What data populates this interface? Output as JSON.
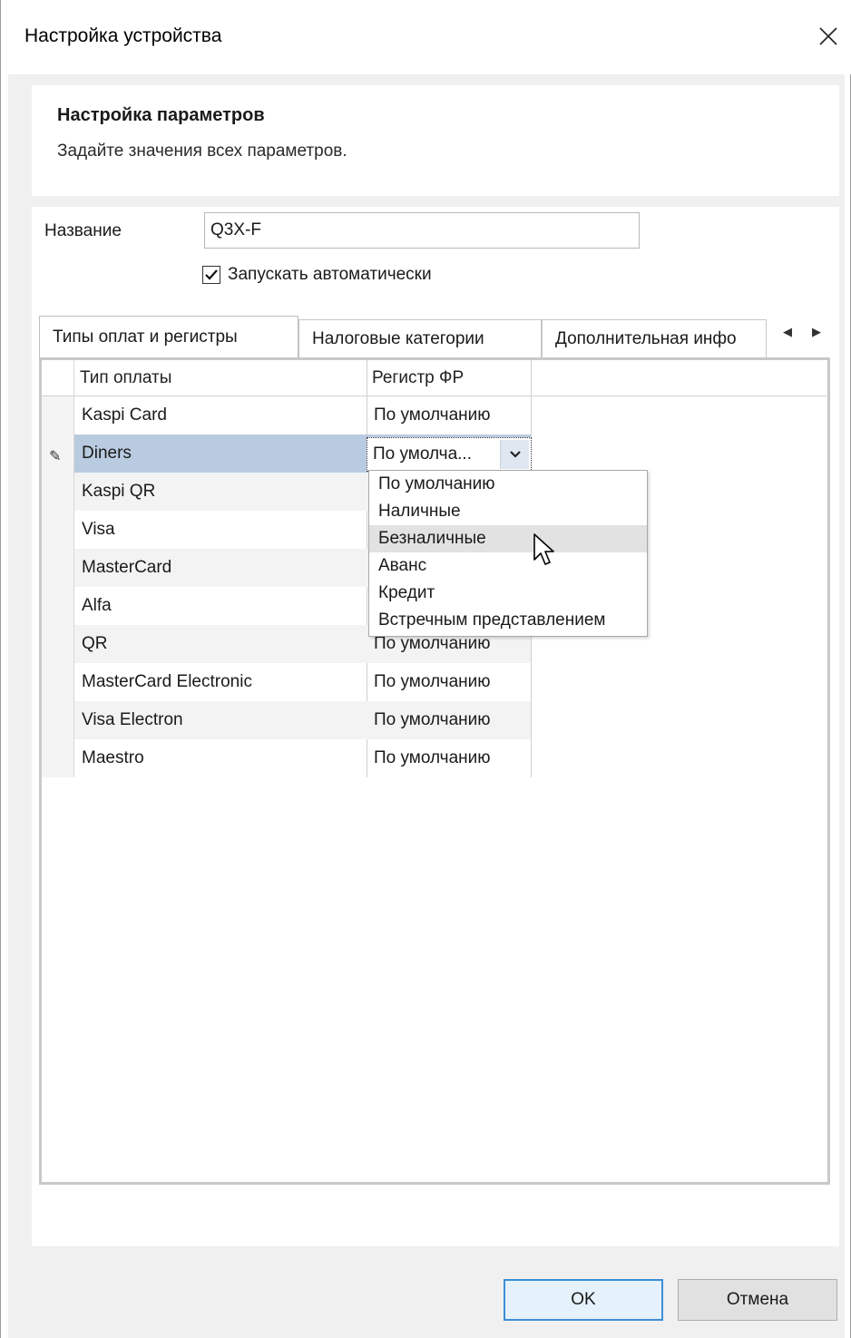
{
  "window": {
    "title": "Настройка устройства"
  },
  "header": {
    "title": "Настройка параметров",
    "subtitle": "Задайте значения всех параметров."
  },
  "form": {
    "name_label": "Название",
    "name_value": "Q3X-F",
    "autostart_label": "Запускать автоматически",
    "autostart_checked": true
  },
  "tabs": [
    {
      "label": "Типы оплат и регистры",
      "active": true
    },
    {
      "label": "Налоговые категории",
      "active": false
    },
    {
      "label": "Дополнительная инфо",
      "active": false
    }
  ],
  "grid": {
    "columns": [
      "Тип оплаты",
      "Регистр ФР"
    ],
    "rows": [
      {
        "type": "Kaspi Card",
        "register": "По умолчанию"
      },
      {
        "type": "Diners",
        "register": "По умолча...",
        "selected": true,
        "editing": true
      },
      {
        "type": "Kaspi QR",
        "register": ""
      },
      {
        "type": "Visa",
        "register": ""
      },
      {
        "type": "MasterCard",
        "register": ""
      },
      {
        "type": "Alfa",
        "register": ""
      },
      {
        "type": "QR",
        "register": "По умолчанию"
      },
      {
        "type": "MasterCard Electronic",
        "register": "По умолчанию"
      },
      {
        "type": "Visa Electron",
        "register": "По умолчанию"
      },
      {
        "type": "Maestro",
        "register": "По умолчанию"
      }
    ]
  },
  "dropdown": {
    "options": [
      "По умолчанию",
      "Наличные",
      "Безналичные",
      "Аванс",
      "Кредит",
      "Встречным представлением"
    ],
    "highlighted": "Безналичные"
  },
  "buttons": {
    "ok": "OK",
    "cancel": "Отмена"
  },
  "icons": {
    "close": "close-icon",
    "check": "checkmark-icon",
    "edit": "pencil-icon",
    "combo": "chevron-down-icon",
    "tab_left": "arrow-left-icon",
    "tab_right": "arrow-right-icon",
    "cursor": "mouse-pointer-icon"
  },
  "colors": {
    "selection": "#b9cbe0",
    "default_button_border": "#3c8fd6",
    "highlight": "#e2e2e2"
  }
}
